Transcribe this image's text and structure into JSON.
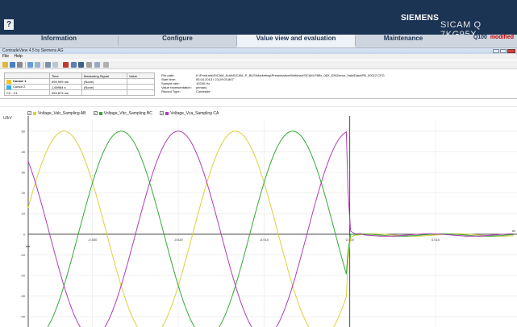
{
  "banner": {
    "help": "?",
    "brand": "SIEMENS",
    "device": "SICAM Q 7KG95X",
    "bg_color": "#1c3454"
  },
  "tabs": [
    {
      "label": "Information",
      "active": false
    },
    {
      "label": "Configure",
      "active": false
    },
    {
      "label": "Value view and evaluation",
      "active": true
    },
    {
      "label": "Maintenance",
      "active": false
    }
  ],
  "status": {
    "model": "Q100",
    "state": "modified"
  },
  "window": {
    "title": "ContradeView 4.5 by Siemens AG",
    "menu": [
      "File",
      "Help"
    ]
  },
  "cursor_table": {
    "headers": [
      "",
      "Time",
      "Measuring Signal",
      "Value"
    ],
    "rows": [
      {
        "name": "Cursor 1",
        "time": "699,999 ms",
        "signal": "(None)",
        "value": "",
        "color": "#f2c531"
      },
      {
        "name": "Cursor 2",
        "time": "1,69984 s",
        "signal": "(None)",
        "value": "",
        "color": "#33b0e8"
      },
      {
        "name": "C2 - C1",
        "time": "999,873 ms",
        "signal": "",
        "value": "",
        "color": ""
      }
    ]
  },
  "file_info": [
    {
      "key": "File path:",
      "value": "K:\\Products\\SICAM_Sold\\SICAM_P_BUS\\Marketing\\Presentation\\Webinar\\SICAM-P85x_06X_EN\\Demo_Vals\\Data\\PB_00012.CFG"
    },
    {
      "key": "Start time:",
      "value": "05.04.2013 / 23:29:03.807"
    },
    {
      "key": "Sample rate:",
      "value": "10240 Hz"
    },
    {
      "key": "Value representation:",
      "value": "primary"
    },
    {
      "key": "Record Type:",
      "value": "Comtrade"
    }
  ],
  "legend": [
    {
      "label": "Voltage_Vab_Sampling AB",
      "color": "#d8d23a",
      "checked": true
    },
    {
      "label": "Voltage_Vbc_Sampling BC",
      "color": "#33aa33",
      "checked": true
    },
    {
      "label": "Voltage_Vca_Sampling CA",
      "color": "#b03bb8",
      "checked": true
    }
  ],
  "chart_data": {
    "type": "line",
    "title": "",
    "xlabel": "t/s",
    "ylabel": "U/kV",
    "xlim": [
      -0.0375,
      0.0195
    ],
    "ylim": [
      -45,
      55
    ],
    "x_ticks": [
      -0.03,
      -0.02,
      -0.01,
      0.0,
      0.01
    ],
    "x_tick_labels": [
      "-0.030",
      "-0.020",
      "-0.010",
      "0.000",
      "0.010"
    ],
    "y_ticks": [
      50,
      40,
      30,
      20,
      10,
      0,
      -10,
      -20,
      -30,
      -40
    ],
    "grid": true,
    "series": [
      {
        "name": "Voltage_Vab_Sampling AB",
        "color": "#d8d23a",
        "amplitude": 50,
        "fault_time": -0.0004,
        "phase_deg": -120
      },
      {
        "name": "Voltage_Vbc_Sampling BC",
        "color": "#33aa33",
        "amplitude": 50,
        "fault_time": -0.0004,
        "phase_deg": 120
      },
      {
        "name": "Voltage_Vca_Sampling CA",
        "color": "#b03bb8",
        "amplitude": 50,
        "fault_time": -0.0004,
        "phase_deg": 0
      }
    ],
    "frequency_hz": 50
  }
}
